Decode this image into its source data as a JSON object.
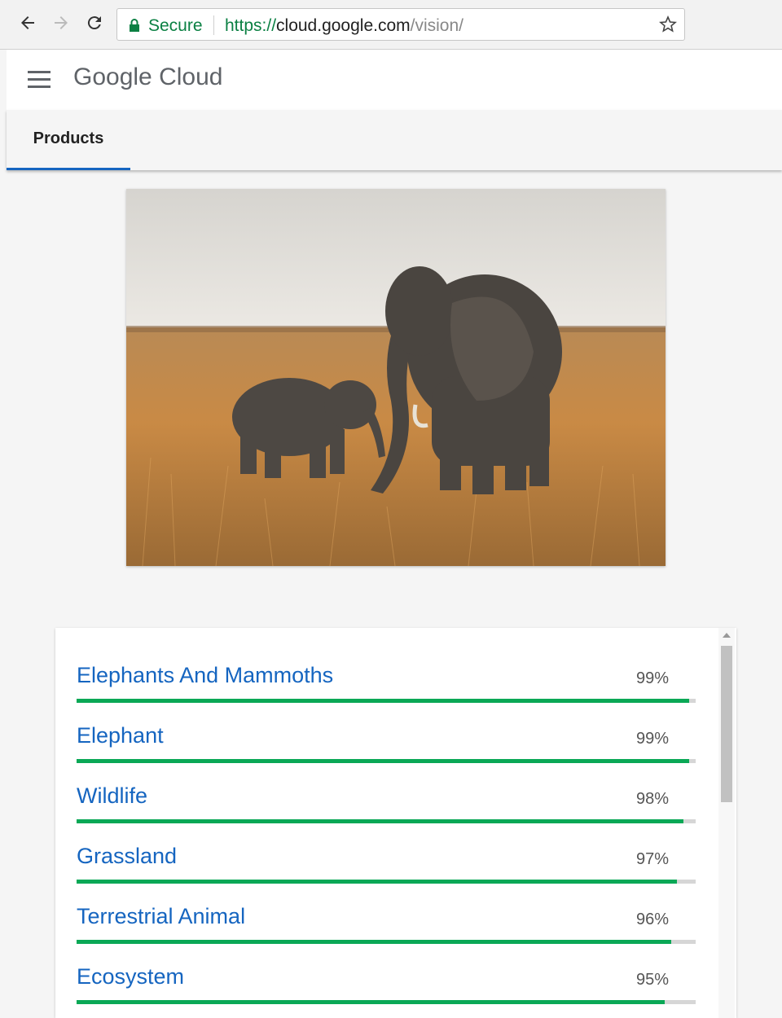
{
  "browser": {
    "secure_label": "Secure",
    "url_protocol": "https://",
    "url_host": "cloud.google.com",
    "url_path": "/vision/"
  },
  "header": {
    "title": "Google Cloud"
  },
  "tabs": {
    "products_label": "Products"
  },
  "labels": [
    {
      "name": "Elephants And Mammoths",
      "score_text": "99%",
      "score": 0.99
    },
    {
      "name": "Elephant",
      "score_text": "99%",
      "score": 0.99
    },
    {
      "name": "Wildlife",
      "score_text": "98%",
      "score": 0.98
    },
    {
      "name": "Grassland",
      "score_text": "97%",
      "score": 0.97
    },
    {
      "name": "Terrestrial Animal",
      "score_text": "96%",
      "score": 0.96
    },
    {
      "name": "Ecosystem",
      "score_text": "95%",
      "score": 0.95
    }
  ],
  "colors": {
    "accent_blue": "#1565c0",
    "bar_green": "#0aa856",
    "secure_green": "#0b8043"
  }
}
